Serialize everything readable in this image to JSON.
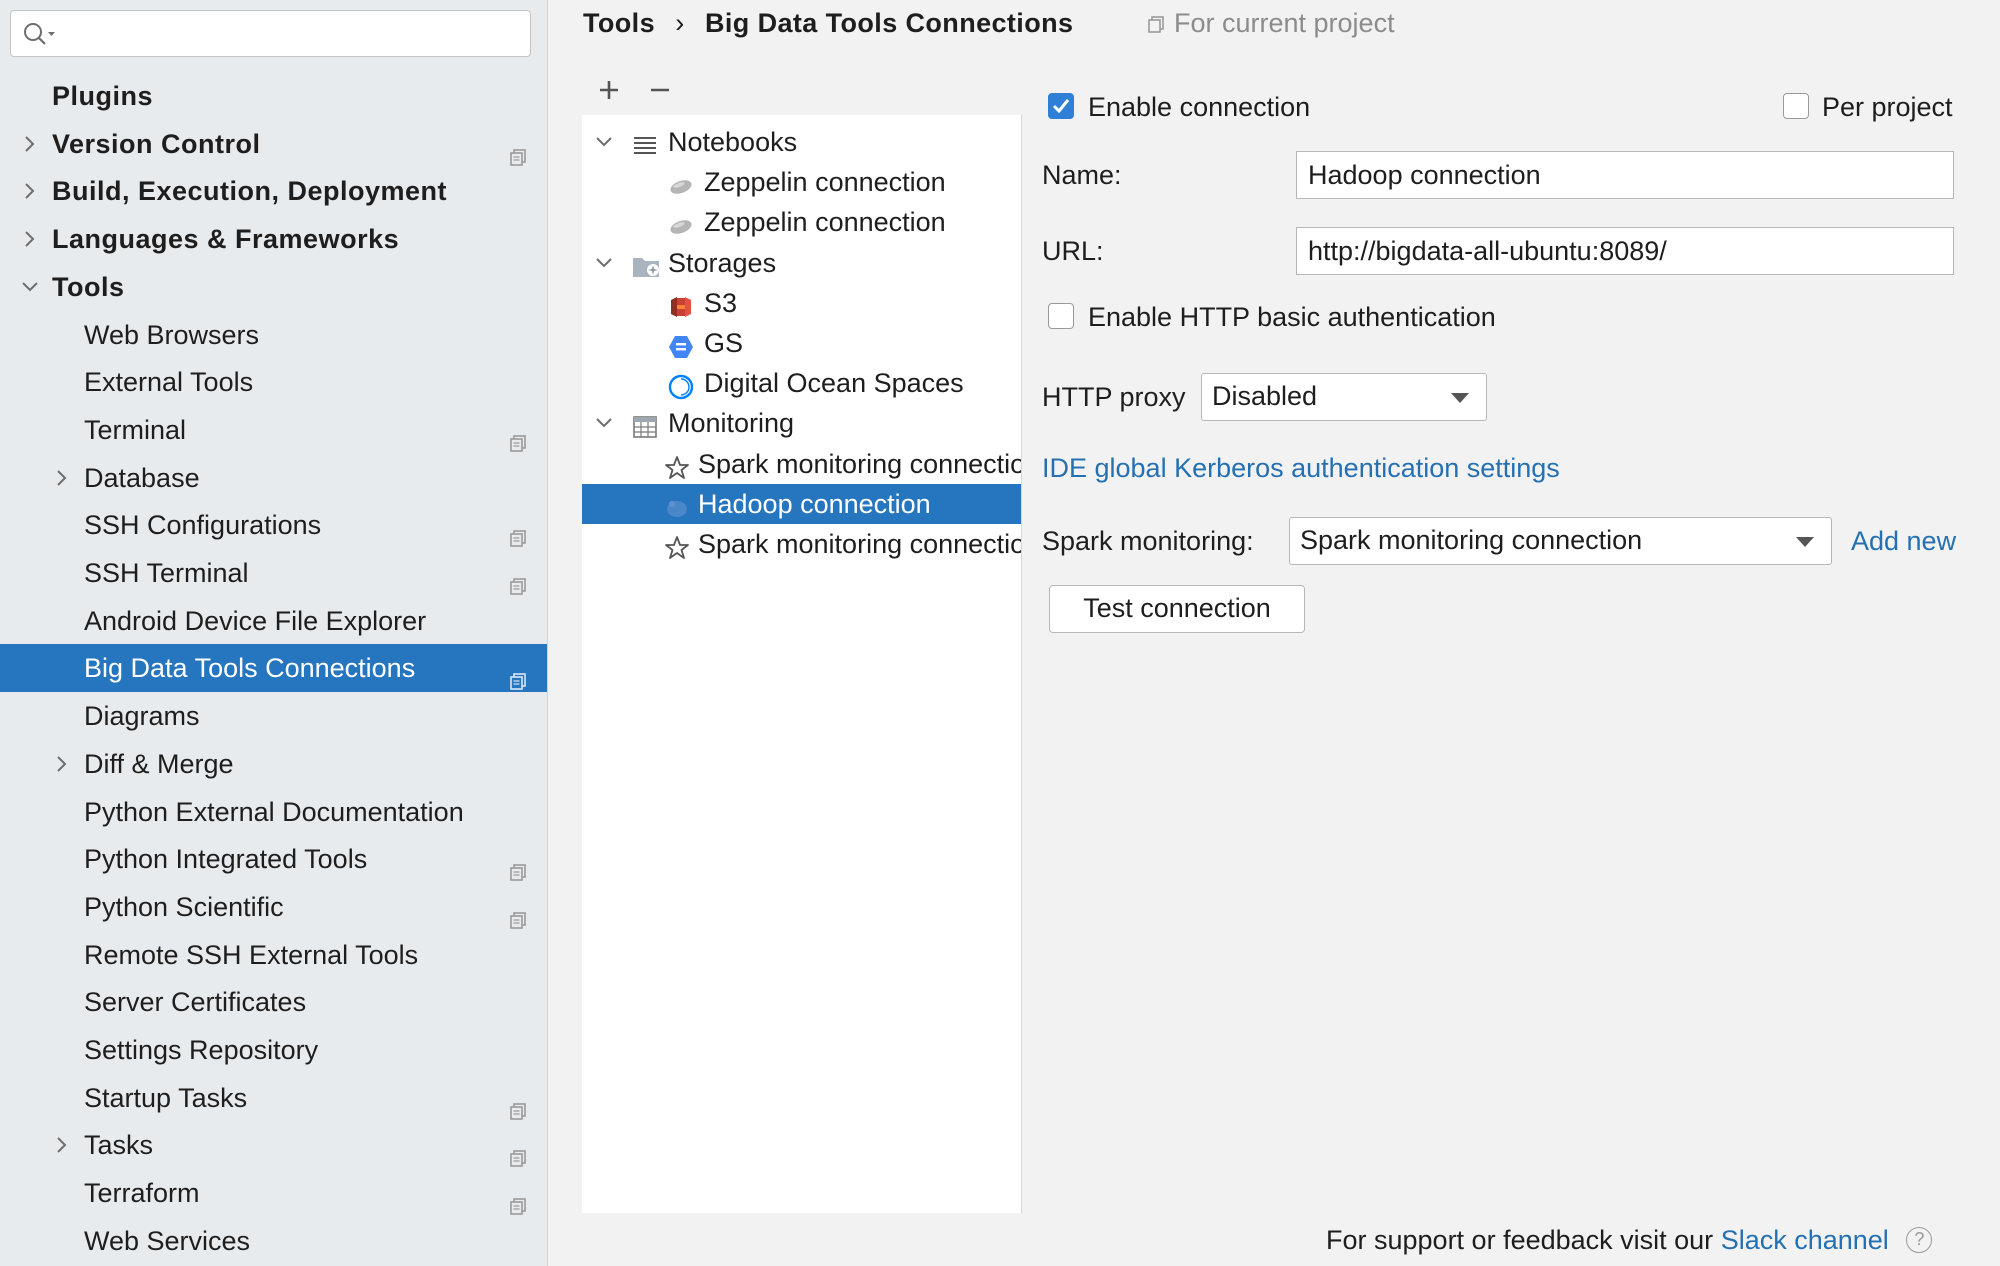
{
  "search": {
    "placeholder": ""
  },
  "sidebar": {
    "items": [
      {
        "label": "Plugins",
        "bold": true,
        "arrow": "none",
        "indent": 0,
        "project": false
      },
      {
        "label": "Version Control",
        "bold": true,
        "arrow": "right",
        "indent": 0,
        "project": true
      },
      {
        "label": "Build, Execution, Deployment",
        "bold": true,
        "arrow": "right",
        "indent": 0,
        "project": false
      },
      {
        "label": "Languages & Frameworks",
        "bold": true,
        "arrow": "right",
        "indent": 0,
        "project": false
      },
      {
        "label": "Tools",
        "bold": true,
        "arrow": "down",
        "indent": 0,
        "project": false
      },
      {
        "label": "Web Browsers",
        "bold": false,
        "arrow": "none",
        "indent": 1,
        "project": false
      },
      {
        "label": "External Tools",
        "bold": false,
        "arrow": "none",
        "indent": 1,
        "project": false
      },
      {
        "label": "Terminal",
        "bold": false,
        "arrow": "none",
        "indent": 1,
        "project": true
      },
      {
        "label": "Database",
        "bold": false,
        "arrow": "right",
        "indent": 1,
        "project": false
      },
      {
        "label": "SSH Configurations",
        "bold": false,
        "arrow": "none",
        "indent": 1,
        "project": true
      },
      {
        "label": "SSH Terminal",
        "bold": false,
        "arrow": "none",
        "indent": 1,
        "project": true
      },
      {
        "label": "Android Device File Explorer",
        "bold": false,
        "arrow": "none",
        "indent": 1,
        "project": false
      },
      {
        "label": "Big Data Tools Connections",
        "bold": false,
        "arrow": "none",
        "indent": 1,
        "project": true,
        "selected": true
      },
      {
        "label": "Diagrams",
        "bold": false,
        "arrow": "none",
        "indent": 1,
        "project": false
      },
      {
        "label": "Diff & Merge",
        "bold": false,
        "arrow": "right",
        "indent": 1,
        "project": false
      },
      {
        "label": "Python External Documentation",
        "bold": false,
        "arrow": "none",
        "indent": 1,
        "project": false
      },
      {
        "label": "Python Integrated Tools",
        "bold": false,
        "arrow": "none",
        "indent": 1,
        "project": true
      },
      {
        "label": "Python Scientific",
        "bold": false,
        "arrow": "none",
        "indent": 1,
        "project": true
      },
      {
        "label": "Remote SSH External Tools",
        "bold": false,
        "arrow": "none",
        "indent": 1,
        "project": false
      },
      {
        "label": "Server Certificates",
        "bold": false,
        "arrow": "none",
        "indent": 1,
        "project": false
      },
      {
        "label": "Settings Repository",
        "bold": false,
        "arrow": "none",
        "indent": 1,
        "project": false
      },
      {
        "label": "Startup Tasks",
        "bold": false,
        "arrow": "none",
        "indent": 1,
        "project": true
      },
      {
        "label": "Tasks",
        "bold": false,
        "arrow": "right",
        "indent": 1,
        "project": true
      },
      {
        "label": "Terraform",
        "bold": false,
        "arrow": "none",
        "indent": 1,
        "project": true
      },
      {
        "label": "Web Services",
        "bold": false,
        "arrow": "none",
        "indent": 1,
        "project": false
      }
    ]
  },
  "breadcrumb": {
    "root": "Tools",
    "separator": "›",
    "current": "Big Data Tools Connections"
  },
  "scope_hint": "For current project",
  "tree_toolbar": {
    "add_symbol": "+",
    "remove_symbol": "−"
  },
  "tree": {
    "rows": [
      {
        "label": "Notebooks",
        "level": 0,
        "expanded": true,
        "icon": "list-icon"
      },
      {
        "label": "Zeppelin connection",
        "level": 1,
        "icon": "zeppelin-icon"
      },
      {
        "label": "Zeppelin connection",
        "level": 1,
        "icon": "zeppelin-icon"
      },
      {
        "label": "Storages",
        "level": 0,
        "expanded": true,
        "icon": "storage-folder-icon"
      },
      {
        "label": "S3",
        "level": 1,
        "icon": "s3-icon"
      },
      {
        "label": "GS",
        "level": 1,
        "icon": "gcs-icon"
      },
      {
        "label": "Digital Ocean Spaces",
        "level": 1,
        "icon": "digital-ocean-icon"
      },
      {
        "label": "Monitoring",
        "level": 0,
        "expanded": true,
        "icon": "table-icon"
      },
      {
        "label": "Spark monitoring connection",
        "level": 1,
        "icon": "spark-icon"
      },
      {
        "label": "Hadoop connection",
        "level": 1,
        "icon": "hadoop-icon",
        "selected": true
      },
      {
        "label": "Spark monitoring connection",
        "level": 1,
        "icon": "spark-icon"
      }
    ]
  },
  "form": {
    "enable_connection": {
      "label": "Enable connection",
      "checked": true
    },
    "per_project": {
      "label": "Per project",
      "checked": false
    },
    "name": {
      "label": "Name:",
      "value": "Hadoop connection"
    },
    "url": {
      "label": "URL:",
      "value": "http://bigdata-all-ubuntu:8089/"
    },
    "basic_auth": {
      "label": "Enable HTTP basic authentication",
      "checked": false
    },
    "http_proxy": {
      "label": "HTTP proxy",
      "value": "Disabled"
    },
    "kerberos_link": "IDE global Kerberos authentication settings",
    "spark_monitoring": {
      "label": "Spark monitoring:",
      "value": "Spark monitoring connection",
      "add_new": "Add new"
    },
    "test_button": "Test connection"
  },
  "footer": {
    "text": "For support or feedback visit our",
    "link": "Slack channel",
    "help": "?"
  },
  "colors": {
    "accent": "#2675bf",
    "link": "#2470b3",
    "sidebar_bg": "#e8ebee",
    "panel_bg": "#f2f2f2"
  }
}
